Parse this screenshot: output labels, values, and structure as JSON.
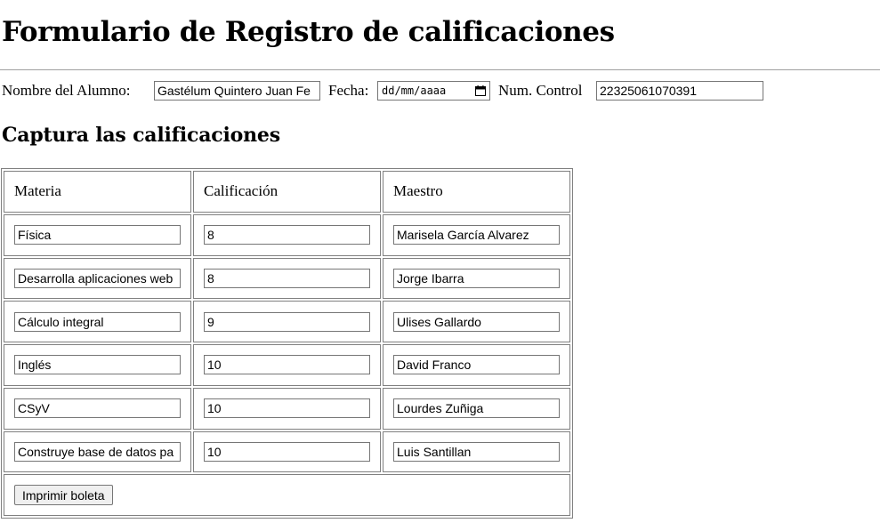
{
  "page": {
    "title": "Formulario de Registro de calificaciones"
  },
  "student": {
    "name_label": "Nombre del Alumno:",
    "name_value": "Gastélum Quintero Juan Fe",
    "date_label": "Fecha:",
    "date_placeholder": "dd/mm/aaaa",
    "control_label": "Num. Control",
    "control_value": "22325061070391"
  },
  "grades": {
    "section_title": "Captura las calificaciones",
    "headers": {
      "materia": "Materia",
      "calificacion": "Calificación",
      "maestro": "Maestro"
    },
    "rows": [
      {
        "materia": "Física",
        "calificacion": "8",
        "maestro": "Marisela García Alvarez"
      },
      {
        "materia": "Desarrolla aplicaciones web",
        "calificacion": "8",
        "maestro": "Jorge Ibarra"
      },
      {
        "materia": "Cálculo integral",
        "calificacion": "9",
        "maestro": "Ulises Gallardo"
      },
      {
        "materia": "Inglés",
        "calificacion": "10",
        "maestro": "David Franco"
      },
      {
        "materia": "CSyV",
        "calificacion": "10",
        "maestro": "Lourdes Zuñiga"
      },
      {
        "materia": "Construye base de datos pa",
        "calificacion": "10",
        "maestro": "Luis Santillan"
      }
    ],
    "print_label": "Imprimir boleta"
  },
  "icons": {
    "date_picker": "calendar-icon"
  },
  "colors": {
    "border": "#808080",
    "input_border": "#767676",
    "button_bg": "#efefef"
  }
}
